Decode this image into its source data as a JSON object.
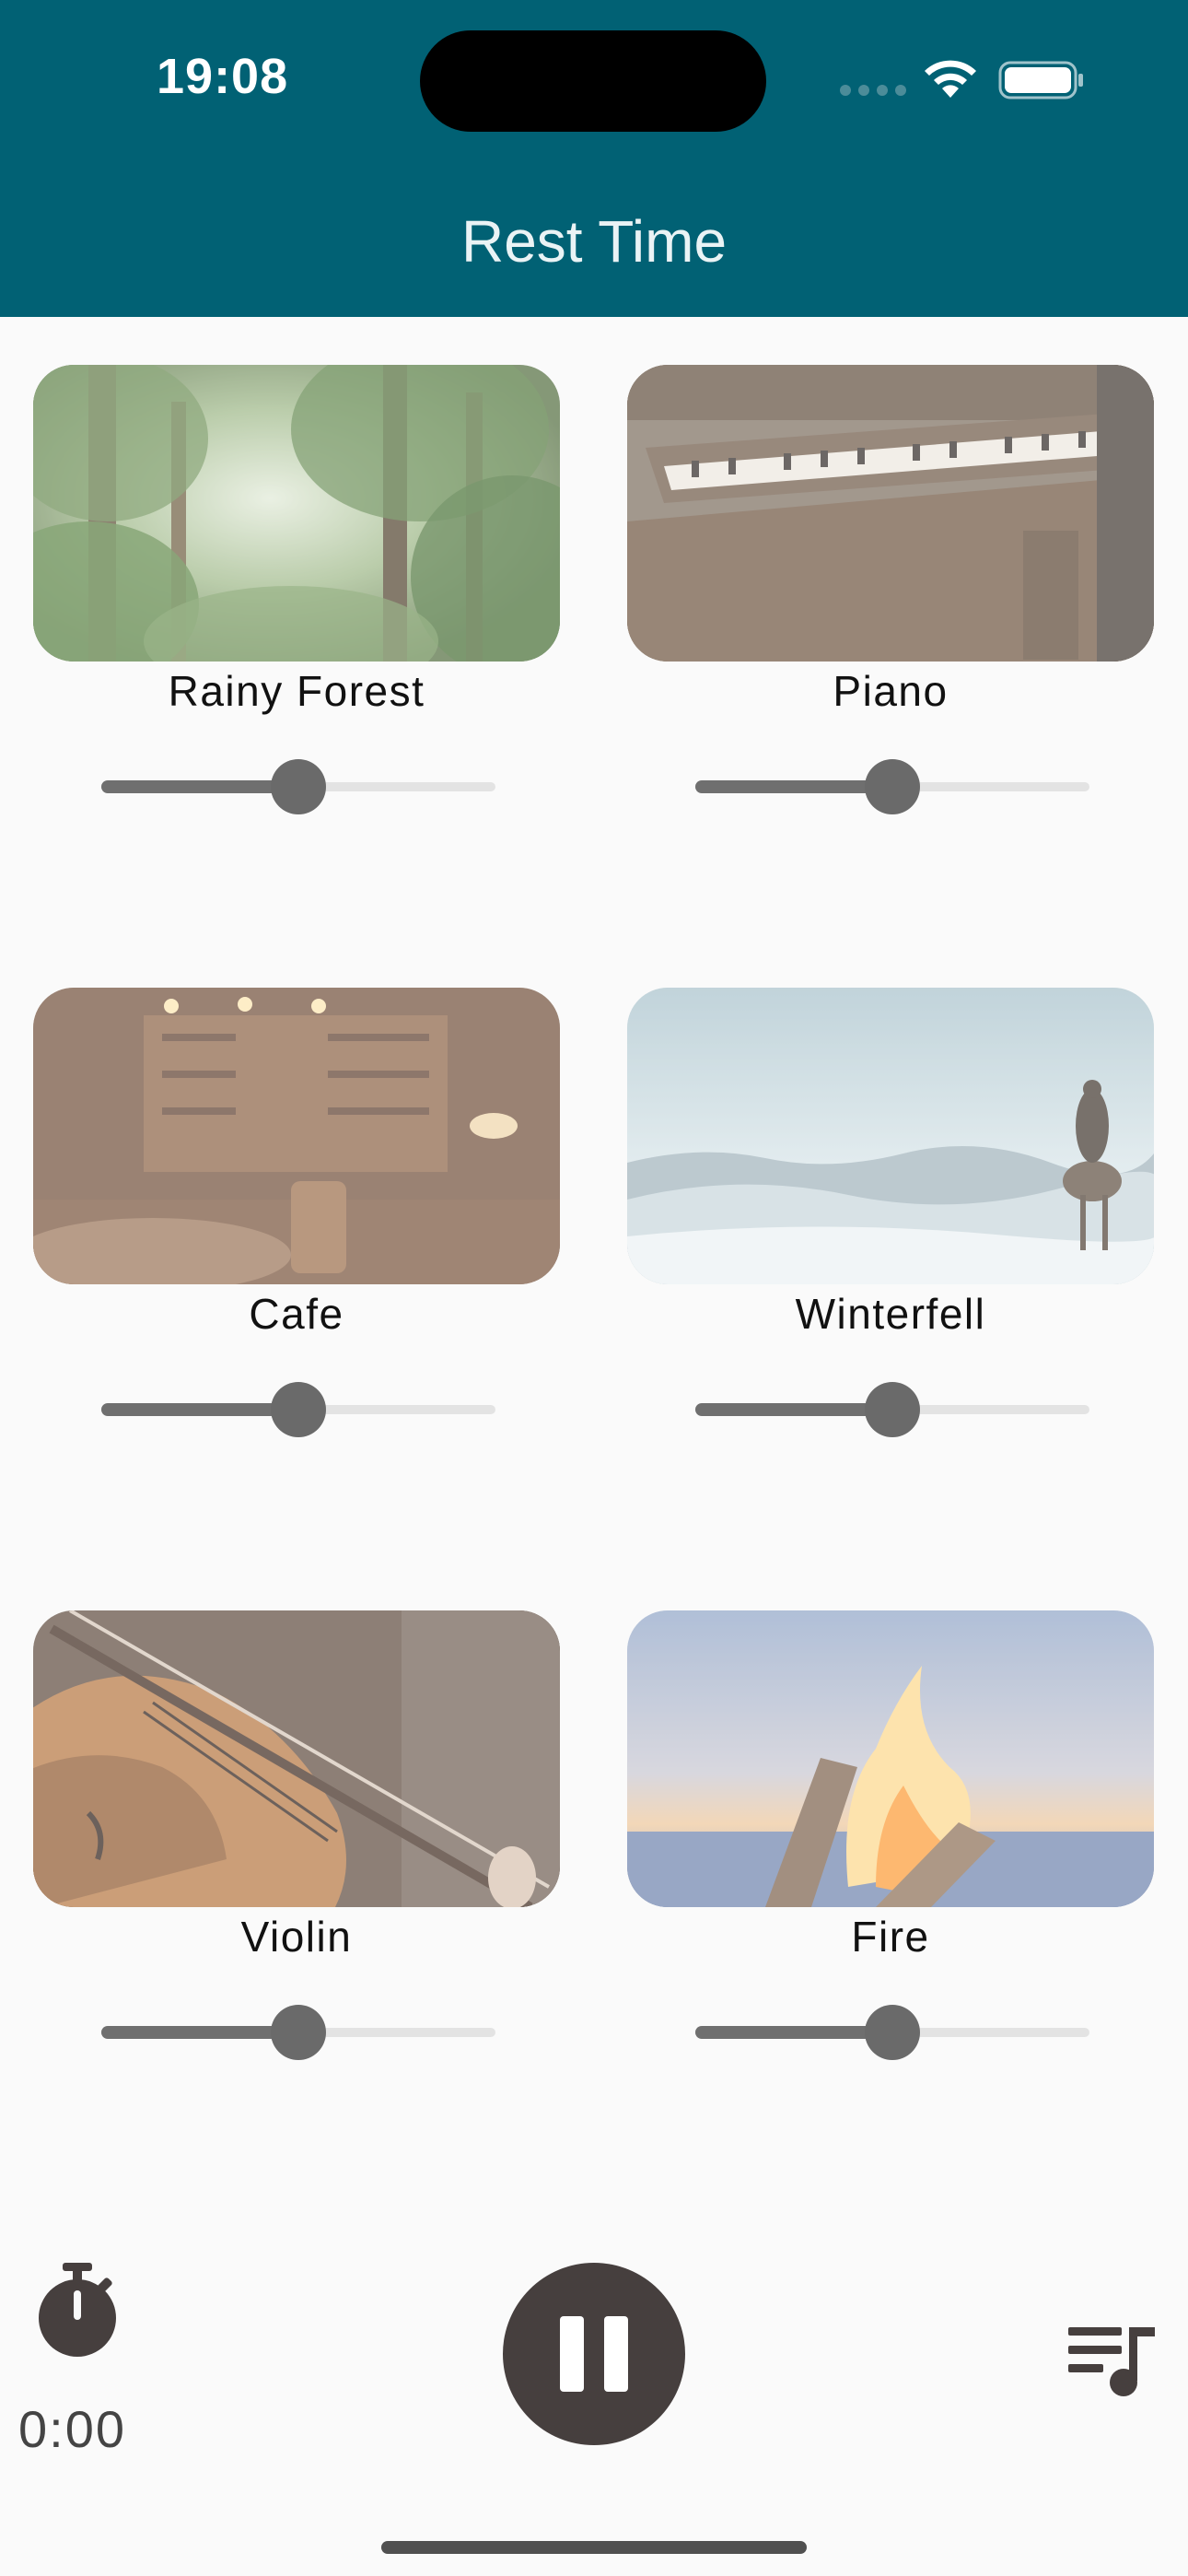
{
  "status_bar": {
    "time": "19:08"
  },
  "header": {
    "title": "Rest Time",
    "background": "#016174"
  },
  "sounds": [
    {
      "label": "Rainy Forest",
      "volume": 0.5,
      "image_icon": "rainy-forest-image"
    },
    {
      "label": "Piano",
      "volume": 0.5,
      "image_icon": "piano-image"
    },
    {
      "label": "Cafe",
      "volume": 0.5,
      "image_icon": "cafe-image"
    },
    {
      "label": "Winterfell",
      "volume": 0.5,
      "image_icon": "winterfell-image"
    },
    {
      "label": "Violin",
      "volume": 0.5,
      "image_icon": "violin-image"
    },
    {
      "label": "Fire",
      "volume": 0.5,
      "image_icon": "fire-image"
    }
  ],
  "controls": {
    "timer_text": "0:00",
    "timer_icon": "stopwatch-icon",
    "play_state_icon": "pause-icon",
    "playlist_icon": "playlist-icon"
  }
}
